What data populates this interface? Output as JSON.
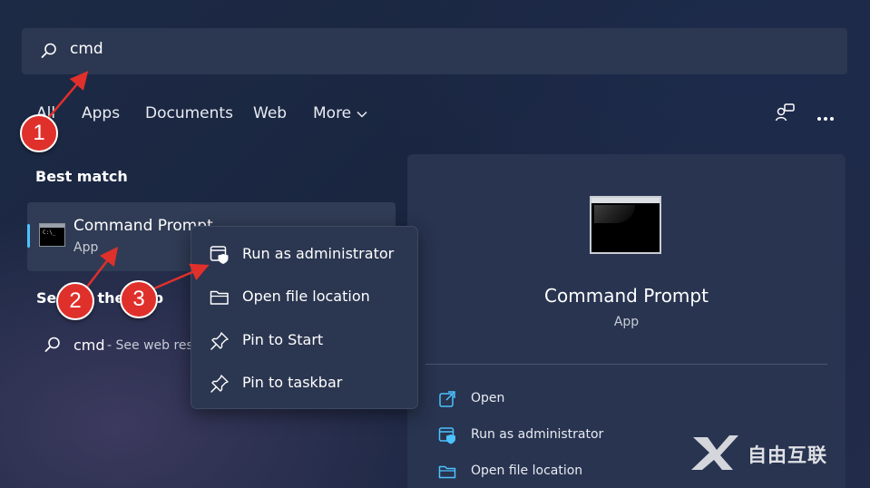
{
  "search": {
    "value": "cmd"
  },
  "tabs": [
    {
      "label": "All"
    },
    {
      "label": "Apps"
    },
    {
      "label": "Documents"
    },
    {
      "label": "Web"
    },
    {
      "label": "More"
    }
  ],
  "best_match": {
    "section_label": "Best match",
    "title": "Command Prompt",
    "subtitle": "App"
  },
  "web": {
    "section_label": "Search the web",
    "query": "cmd",
    "hint": "- See web res"
  },
  "context_menu": {
    "items": [
      {
        "label": "Run as administrator",
        "icon": "shield-window-icon"
      },
      {
        "label": "Open file location",
        "icon": "folder-icon"
      },
      {
        "label": "Pin to Start",
        "icon": "pin-icon"
      },
      {
        "label": "Pin to taskbar",
        "icon": "pin-icon"
      }
    ]
  },
  "details": {
    "title": "Command Prompt",
    "subtitle": "App",
    "actions": [
      {
        "label": "Open",
        "icon": "open-external-icon"
      },
      {
        "label": "Run as administrator",
        "icon": "shield-window-icon"
      },
      {
        "label": "Open file location",
        "icon": "folder-icon"
      }
    ]
  },
  "annotations": [
    {
      "number": "1"
    },
    {
      "number": "2"
    },
    {
      "number": "3"
    }
  ],
  "watermark": {
    "text": "自由互联"
  },
  "colors": {
    "accent": "#4cc2ff",
    "badge": "#e0302b",
    "panel": "#283450",
    "menu": "#2b3650"
  }
}
